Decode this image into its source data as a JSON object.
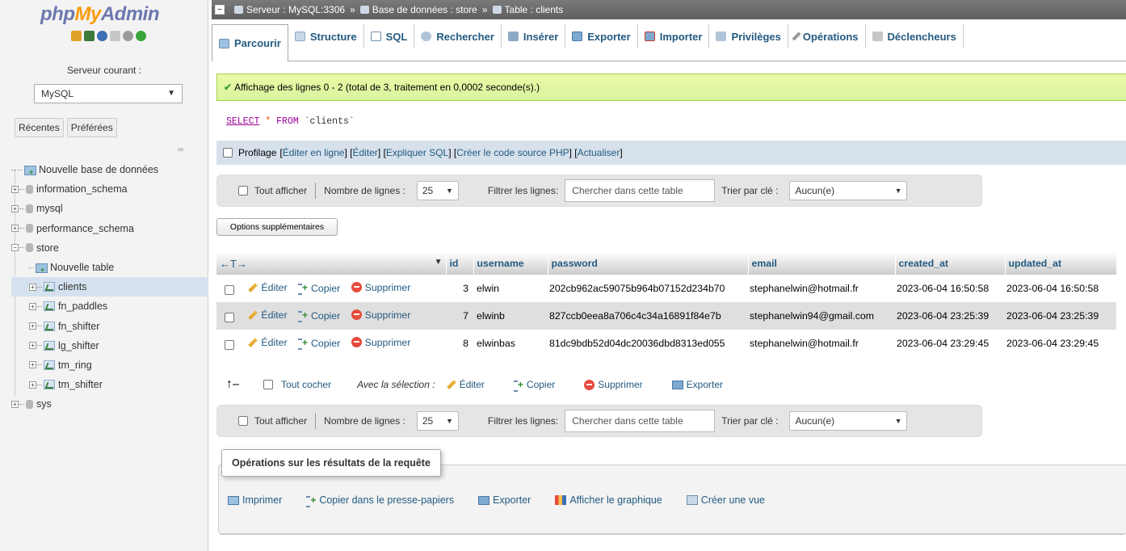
{
  "sidebar": {
    "logo": {
      "php": "php",
      "my": "My",
      "admin": "Admin"
    },
    "server_label": "Serveur courant :",
    "server_value": "MySQL",
    "tabs": [
      "Récentes",
      "Préférées"
    ],
    "tree": [
      {
        "label": "Nouvelle base de données",
        "type": "new-db"
      },
      {
        "label": "information_schema",
        "type": "db"
      },
      {
        "label": "mysql",
        "type": "db"
      },
      {
        "label": "performance_schema",
        "type": "db"
      },
      {
        "label": "store",
        "type": "db-open"
      },
      {
        "label": "Nouvelle table",
        "type": "new-table"
      },
      {
        "label": "clients",
        "type": "table",
        "active": true
      },
      {
        "label": "fn_paddles",
        "type": "table"
      },
      {
        "label": "fn_shifter",
        "type": "table"
      },
      {
        "label": "lg_shifter",
        "type": "table"
      },
      {
        "label": "tm_ring",
        "type": "table"
      },
      {
        "label": "tm_shifter",
        "type": "table"
      },
      {
        "label": "sys",
        "type": "db"
      }
    ]
  },
  "breadcrumb": {
    "server": "Serveur : MySQL:3306",
    "database": "Base de données : store",
    "table": "Table : clients",
    "sep": "»"
  },
  "tabs": [
    "Parcourir",
    "Structure",
    "SQL",
    "Rechercher",
    "Insérer",
    "Exporter",
    "Importer",
    "Privilèges",
    "Opérations",
    "Déclencheurs"
  ],
  "success_message": "Affichage des lignes 0 - 2 (total de 3, traitement en 0,0002 seconde(s).)",
  "sql": {
    "select": "SELECT",
    "star": "*",
    "from": "FROM",
    "table": "`clients`"
  },
  "profile": {
    "label": "Profilage",
    "links": [
      "Éditer en ligne",
      "Éditer",
      "Expliquer SQL",
      "Créer le code source PHP",
      "Actualiser"
    ]
  },
  "navigation": {
    "show_all": "Tout afficher",
    "rows_label": "Nombre de lignes :",
    "rows_value": "25",
    "filter_label": "Filtrer les lignes:",
    "filter_placeholder": "Chercher dans cette table",
    "sort_label": "Trier par clé :",
    "sort_value": "Aucun(e)"
  },
  "more_options": "Options supplémentaires",
  "table": {
    "columns": [
      "id",
      "username",
      "password",
      "email",
      "created_at",
      "updated_at"
    ],
    "actions": {
      "edit": "Éditer",
      "copy": "Copier",
      "delete": "Supprimer"
    },
    "rows": [
      {
        "id": "3",
        "username": "elwin",
        "password": "202cb962ac59075b964b07152d234b70",
        "email": "stephanelwin@hotmail.fr",
        "created_at": "2023-06-04 16:50:58",
        "updated_at": "2023-06-04 16:50:58"
      },
      {
        "id": "7",
        "username": "elwinb",
        "password": "827ccb0eea8a706c4c34a16891f84e7b",
        "email": "stephanelwin94@gmail.com",
        "created_at": "2023-06-04 23:25:39",
        "updated_at": "2023-06-04 23:25:39"
      },
      {
        "id": "8",
        "username": "elwinbas",
        "password": "81dc9bdb52d04dc20036dbd8313ed055",
        "email": "stephanelwin@hotmail.fr",
        "created_at": "2023-06-04 23:29:45",
        "updated_at": "2023-06-04 23:29:45"
      }
    ]
  },
  "bulk": {
    "check_all": "Tout cocher",
    "with_selected": "Avec la sélection :",
    "edit": "Éditer",
    "copy": "Copier",
    "delete": "Supprimer",
    "export": "Exporter"
  },
  "query_ops": {
    "legend": "Opérations sur les résultats de la requête",
    "items": [
      "Imprimer",
      "Copier dans le presse-papiers",
      "Exporter",
      "Afficher le graphique",
      "Créer une vue"
    ]
  },
  "colors": {
    "link": "#235a81",
    "success_bg": "#ebf8a4",
    "accent_orange": "#f89c0e"
  }
}
